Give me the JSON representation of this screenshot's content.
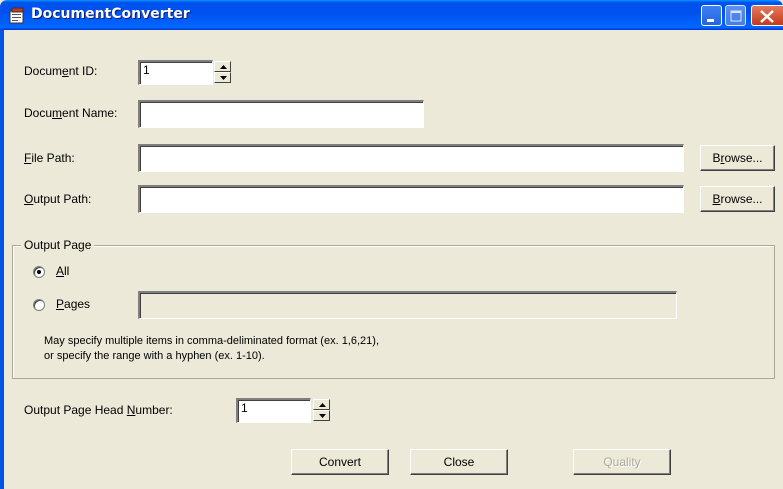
{
  "window": {
    "title": "DocumentConverter",
    "icon": "document-app-icon",
    "controls": [
      "minimize-icon",
      "maximize-icon",
      "close-icon"
    ]
  },
  "fields": {
    "document_id": {
      "label_pre": "Docum",
      "label_key": "e",
      "label_post": "nt ID:",
      "value": "1"
    },
    "document_name": {
      "label_pre": "Docu",
      "label_key": "m",
      "label_post": "ent Name:",
      "value": ""
    },
    "file_path": {
      "label_key": "F",
      "label_post": "ile Path:",
      "value": "",
      "browse_pre": "B",
      "browse_key": "r",
      "browse_post": "owse..."
    },
    "output_path": {
      "label_key": "O",
      "label_post": "utput Path:",
      "value": "",
      "browse_key": "B",
      "browse_post": "rowse..."
    }
  },
  "output_page": {
    "group_title": "Output Page",
    "all": {
      "label_key": "A",
      "label_post": "ll",
      "selected": true
    },
    "pages": {
      "label_key": "P",
      "label_post": "ages",
      "selected": false,
      "value": ""
    },
    "note_line1": "May specify multiple items in comma-deliminated format (ex. 1,6,21),",
    "note_line2": "or specify the range with a hyphen (ex. 1-10)."
  },
  "head_number": {
    "label_pre": "Output Page Head ",
    "label_key": "N",
    "label_post": "umber:",
    "value": "1"
  },
  "buttons": {
    "convert": "Convert",
    "close": "Close",
    "quality": "Quality"
  }
}
